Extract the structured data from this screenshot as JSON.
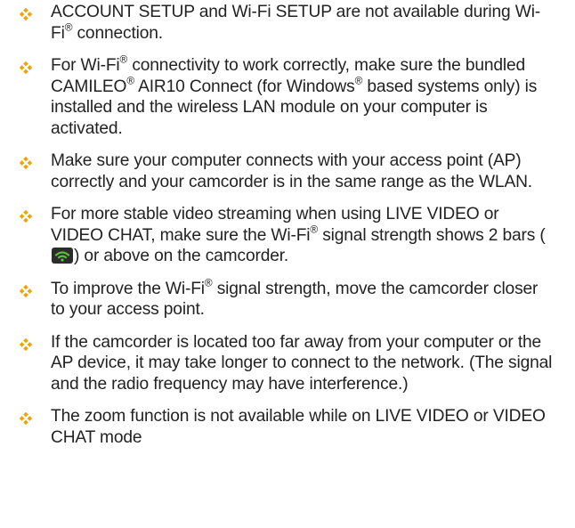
{
  "colors": {
    "bullet": "#f0a30a",
    "text": "#222222",
    "wifi_icon_bg": "#2c2c2c",
    "wifi_icon_bars": "#5cc03b"
  },
  "icons": {
    "bullet": "diamond-cluster-icon",
    "signal": "wifi-signal-2-bars-icon"
  },
  "notes": [
    {
      "a": "ACCOUNT SETUP and Wi-Fi SETUP are not available during Wi-Fi",
      "reg": "®",
      "b": " connection."
    },
    {
      "a": "For Wi-Fi",
      "reg1": "®",
      "b": " connectivity to work correctly, make sure the bundled CAMILEO",
      "reg2": "®",
      "c": " AIR10 Connect (for Windows",
      "reg3": "®",
      "d": " based systems only) is installed and the wireless LAN module on your computer is activated."
    },
    {
      "a": "Make sure your computer connects with your access point (AP) correctly and your camcorder is in the same range as the WLAN."
    },
    {
      "a": "For more stable video streaming when using LIVE VIDEO or VIDEO CHAT, make sure the Wi-Fi",
      "reg": "®",
      "b": " signal strength shows 2 bars (",
      "c": ") or above on the camcorder."
    },
    {
      "a": "To improve the Wi-Fi",
      "reg": "®",
      "b": " signal strength, move the camcorder closer to your access point."
    },
    {
      "a": "If the camcorder is located too far away from your computer or the AP device, it may take longer to connect to the network. (The signal and the radio frequency may have interference.)"
    },
    {
      "a": "The zoom function is not available while on LIVE VIDEO or VIDEO CHAT mode"
    }
  ]
}
